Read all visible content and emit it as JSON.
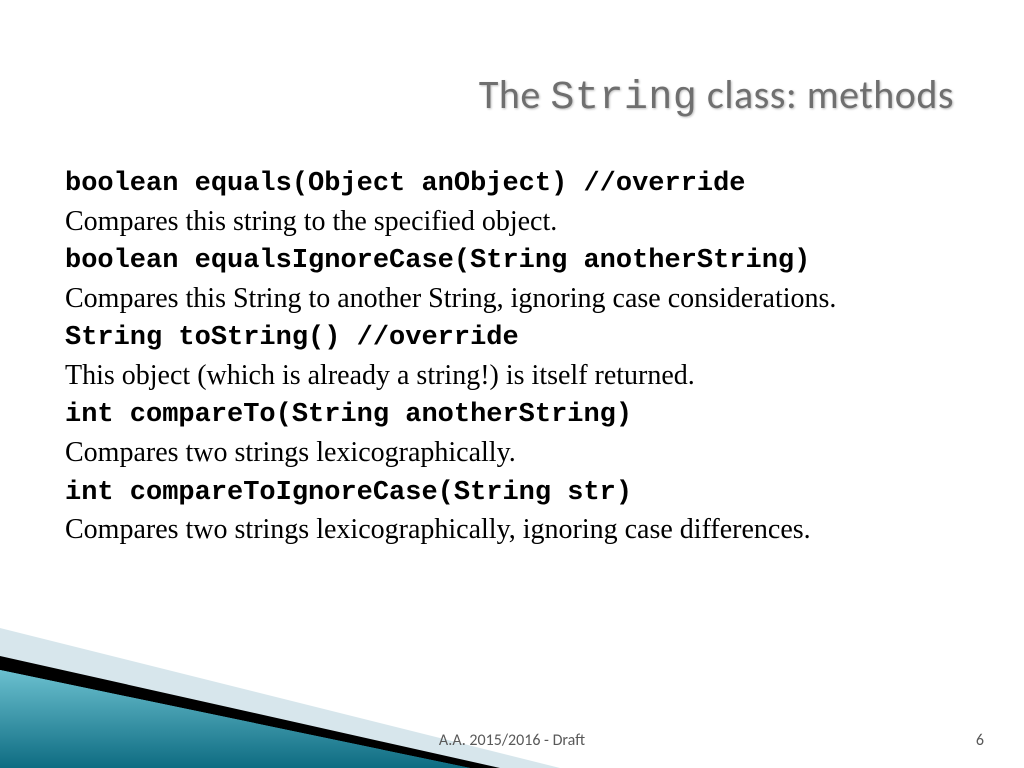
{
  "title": {
    "pre": "The ",
    "code": "String",
    "post": " class: methods"
  },
  "methods": [
    {
      "sig": "boolean equals(Object anObject) //override",
      "desc": "Compares this string to the specified object."
    },
    {
      "sig": "boolean equalsIgnoreCase(String anotherString)",
      "desc": "Compares this String to another String, ignoring case considerations."
    },
    {
      "sig": "String toString() //override",
      "desc": "This object (which is already a string!) is itself returned."
    },
    {
      "sig": "int compareTo(String anotherString)",
      "desc": "Compares two strings lexicographically."
    },
    {
      "sig": "int compareToIgnoreCase(String str)",
      "desc": "Compares two strings lexicographically, ignoring case differences."
    }
  ],
  "footer": "A.A. 2015/2016  -  Draft",
  "page": "6"
}
